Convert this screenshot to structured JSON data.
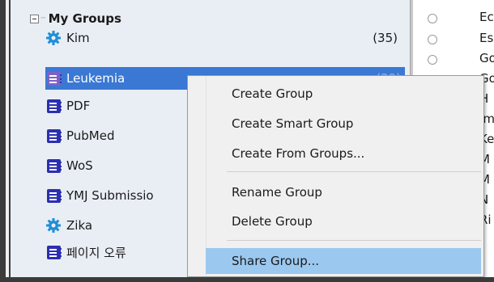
{
  "tree": {
    "header_label": "My Groups",
    "items": [
      {
        "label": "Kim",
        "count": "(35)",
        "icon": "gear-icon"
      },
      {
        "label": "Leukemia",
        "count": "(39)",
        "icon": "doc-icon"
      },
      {
        "label": "PDF",
        "count": "",
        "icon": "doc-icon"
      },
      {
        "label": "PubMed",
        "count": "",
        "icon": "doc-icon"
      },
      {
        "label": "WoS",
        "count": "",
        "icon": "doc-icon"
      },
      {
        "label": "YMJ Submissio",
        "count": "",
        "icon": "doc-icon"
      },
      {
        "label": "Zika",
        "count": "",
        "icon": "gear-icon"
      },
      {
        "label": "페이지 오류",
        "count": "",
        "icon": "doc-icon"
      }
    ]
  },
  "reference_list": {
    "items": [
      "Ec",
      "Es",
      "Go",
      "Go",
      "H",
      "Im",
      "Ke",
      "M",
      "M",
      "N",
      "Ri"
    ]
  },
  "context_menu": {
    "items": [
      {
        "label": "Create Group"
      },
      {
        "label": "Create Smart Group"
      },
      {
        "label": "Create From Groups..."
      },
      {
        "label": "Rename Group"
      },
      {
        "label": "Delete Group"
      },
      {
        "label": "Share Group..."
      }
    ]
  },
  "colors": {
    "selection": "#3a78d4",
    "menu_highlight": "#9bc8ef",
    "group_icon": "#2b2fb0",
    "smart_group_icon": "#1f8fd6"
  }
}
